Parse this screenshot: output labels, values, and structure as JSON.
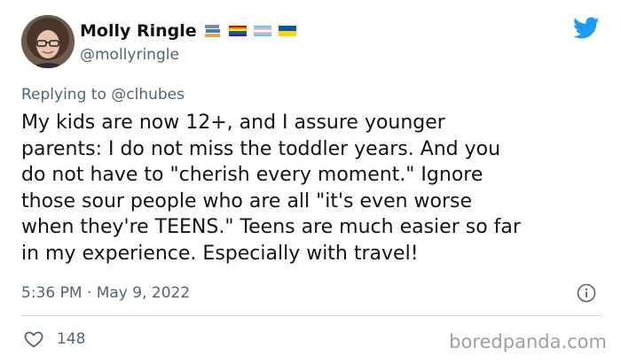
{
  "author": {
    "name": "Molly Ringle",
    "handle": "@mollyringle",
    "avatar_icon": "profile-photo-avatar",
    "badge_emojis": [
      "books-emoji",
      "rainbow-flag-emoji",
      "transgender-flag-emoji",
      "ukraine-flag-emoji"
    ]
  },
  "brand_icon": "twitter-bird-icon",
  "brand_color": "#1d9bf0",
  "reply": {
    "text": "Replying to @clhubes"
  },
  "tweet": {
    "text": "My kids are now 12+, and I assure younger\nparents: I do not miss the toddler years. And you\ndo not have to \"cherish every moment.\" Ignore\nthose sour people who are all \"it's even worse\nwhen they're TEENS.\" Teens are much easier so far\nin my experience. Especially with travel!",
    "timestamp": "5:36 PM · May 9, 2022"
  },
  "engagement": {
    "likes": "148",
    "like_icon": "heart-icon",
    "info_icon": "info-icon"
  },
  "watermark": "boredpanda.com"
}
